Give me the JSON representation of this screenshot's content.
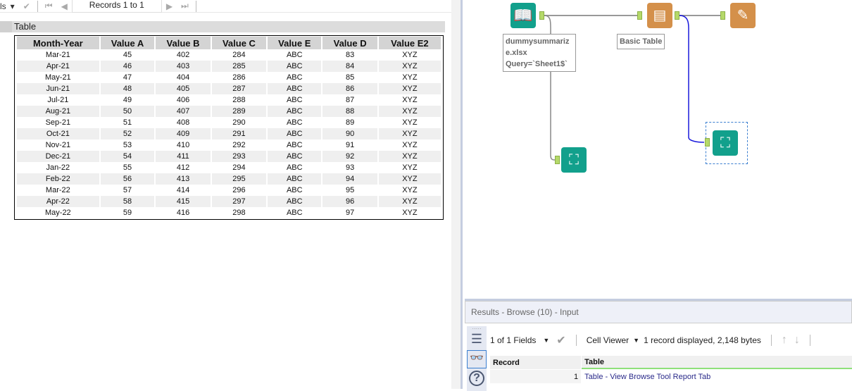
{
  "toolbar": {
    "fields_partial": "ls",
    "records": "Records 1 to 1"
  },
  "report": {
    "title": "Table",
    "headers": [
      "Month-Year",
      "Value A",
      "Value B",
      "Value C",
      "Value E",
      "Value D",
      "Value E2"
    ],
    "rows": [
      [
        "Mar-21",
        "45",
        "402",
        "284",
        "ABC",
        "83",
        "XYZ"
      ],
      [
        "Apr-21",
        "46",
        "403",
        "285",
        "ABC",
        "84",
        "XYZ"
      ],
      [
        "May-21",
        "47",
        "404",
        "286",
        "ABC",
        "85",
        "XYZ"
      ],
      [
        "Jun-21",
        "48",
        "405",
        "287",
        "ABC",
        "86",
        "XYZ"
      ],
      [
        "Jul-21",
        "49",
        "406",
        "288",
        "ABC",
        "87",
        "XYZ"
      ],
      [
        "Aug-21",
        "50",
        "407",
        "289",
        "ABC",
        "88",
        "XYZ"
      ],
      [
        "Sep-21",
        "51",
        "408",
        "290",
        "ABC",
        "89",
        "XYZ"
      ],
      [
        "Oct-21",
        "52",
        "409",
        "291",
        "ABC",
        "90",
        "XYZ"
      ],
      [
        "Nov-21",
        "53",
        "410",
        "292",
        "ABC",
        "91",
        "XYZ"
      ],
      [
        "Dec-21",
        "54",
        "411",
        "293",
        "ABC",
        "92",
        "XYZ"
      ],
      [
        "Jan-22",
        "55",
        "412",
        "294",
        "ABC",
        "93",
        "XYZ"
      ],
      [
        "Feb-22",
        "56",
        "413",
        "295",
        "ABC",
        "94",
        "XYZ"
      ],
      [
        "Mar-22",
        "57",
        "414",
        "296",
        "ABC",
        "95",
        "XYZ"
      ],
      [
        "Apr-22",
        "58",
        "415",
        "297",
        "ABC",
        "96",
        "XYZ"
      ],
      [
        "May-22",
        "59",
        "416",
        "298",
        "ABC",
        "97",
        "XYZ"
      ]
    ]
  },
  "workflow": {
    "input_label": [
      "dummysummariz",
      "e.xlsx",
      "Query=`Sheet1$`"
    ],
    "table_label": "Basic Table",
    "colors": {
      "input": "#12a08c",
      "report": "#d4904a",
      "browse": "#12a08c",
      "anchor": "#b5d96a"
    }
  },
  "results": {
    "header": "Results - Browse (10) - Input",
    "fields": "1 of 1 Fields",
    "viewer": "Cell Viewer",
    "status": "1 record displayed, 2,148 bytes",
    "columns": [
      "Record",
      "Table"
    ],
    "row": {
      "record": "1",
      "value": "Table - View Browse Tool Report Tab"
    }
  }
}
